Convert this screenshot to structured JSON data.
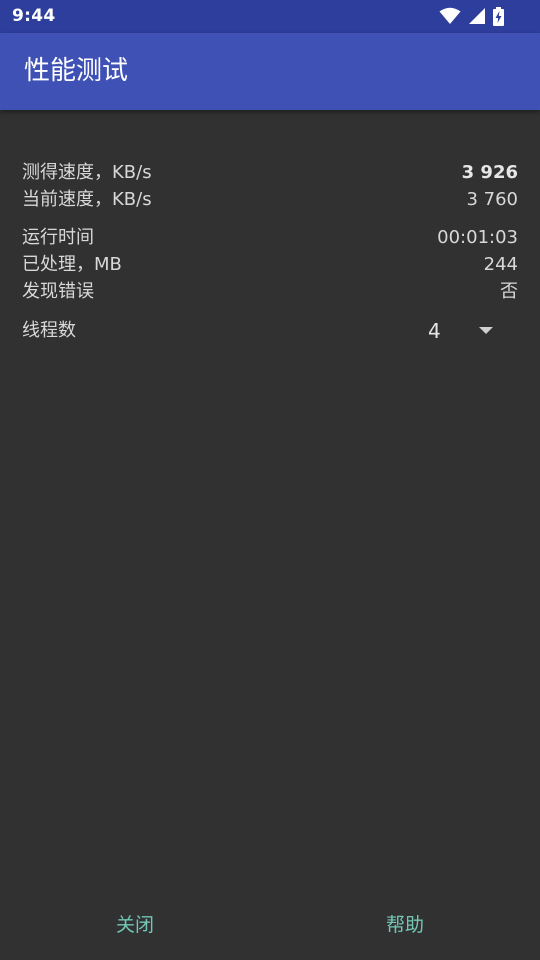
{
  "status_bar": {
    "time": "9:44",
    "icons": [
      "wifi-icon",
      "signal-icon",
      "battery-charging-icon"
    ]
  },
  "app_bar": {
    "title": "性能测试",
    "color": "#3f51b5"
  },
  "stats": {
    "measured_speed": {
      "label": "测得速度，KB/s",
      "value": "3 926"
    },
    "current_speed": {
      "label": "当前速度，KB/s",
      "value": "3 760"
    },
    "run_time": {
      "label": "运行时间",
      "value": "00:01:03"
    },
    "processed": {
      "label": "已处理，MB",
      "value": "244"
    },
    "errors": {
      "label": "发现错误",
      "value": "否"
    }
  },
  "threads": {
    "label": "线程数",
    "selected": "4"
  },
  "buttons": {
    "close": "关闭",
    "help": "帮助",
    "color": "#73c6b6"
  }
}
